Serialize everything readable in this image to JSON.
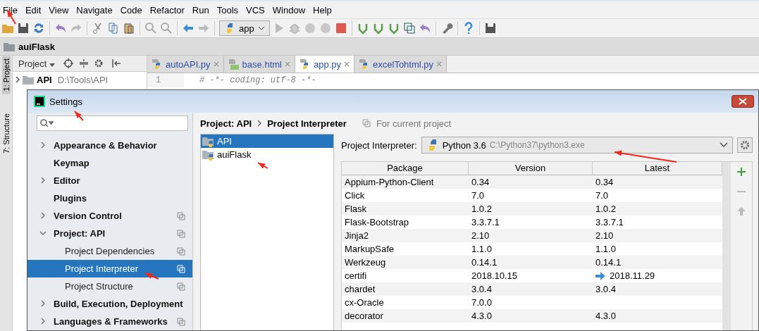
{
  "menu": [
    "File",
    "Edit",
    "View",
    "Navigate",
    "Code",
    "Refactor",
    "Run",
    "Tools",
    "VCS",
    "Window",
    "Help"
  ],
  "toolbar": {
    "run_config": "app"
  },
  "navbar": {
    "breadcrumb": "auiFlask"
  },
  "tool_strip": [
    {
      "label": "1: Project",
      "selected": true
    },
    {
      "label": "7: Structure",
      "selected": false
    }
  ],
  "project_panel": {
    "title": "Project",
    "tree": [
      {
        "name": "API",
        "path": "D:\\Tools\\API",
        "expanded": false
      }
    ]
  },
  "editor": {
    "tabs": [
      {
        "label": "autoAPI.py",
        "kind": "python",
        "selected": false
      },
      {
        "label": "base.html",
        "kind": "html",
        "selected": false
      },
      {
        "label": "app.py",
        "kind": "python",
        "selected": true
      },
      {
        "label": "excelTohtml.py",
        "kind": "python",
        "selected": false
      }
    ],
    "lines": [
      {
        "number": "1",
        "text": "# -*- coding: utf-8 -*-"
      }
    ]
  },
  "settings": {
    "title": "Settings",
    "nav": [
      {
        "label": "Appearance & Behavior",
        "kind": "group",
        "expanded": false,
        "selected": false,
        "project_scoped": false
      },
      {
        "label": "Keymap",
        "kind": "page",
        "selected": false,
        "project_scoped": false
      },
      {
        "label": "Editor",
        "kind": "group",
        "expanded": false,
        "selected": false,
        "project_scoped": false
      },
      {
        "label": "Plugins",
        "kind": "page",
        "selected": false,
        "project_scoped": false
      },
      {
        "label": "Version Control",
        "kind": "group",
        "expanded": false,
        "selected": false,
        "project_scoped": true
      },
      {
        "label": "Project: API",
        "kind": "group",
        "expanded": true,
        "selected": false,
        "project_scoped": true,
        "children": [
          {
            "label": "Project Dependencies",
            "selected": false,
            "project_scoped": true
          },
          {
            "label": "Project Interpreter",
            "selected": true,
            "project_scoped": true
          },
          {
            "label": "Project Structure",
            "selected": false,
            "project_scoped": true
          }
        ]
      },
      {
        "label": "Build, Execution, Deployment",
        "kind": "group",
        "expanded": false,
        "selected": false,
        "project_scoped": false
      },
      {
        "label": "Languages & Frameworks",
        "kind": "group",
        "expanded": false,
        "selected": false,
        "project_scoped": true
      }
    ],
    "breadcrumb": [
      "Project: API",
      "Project Interpreter"
    ],
    "scope_note": "For current project",
    "projects": [
      {
        "name": "API",
        "selected": true
      },
      {
        "name": "auiFlask",
        "selected": false
      }
    ],
    "interpreter": {
      "label": "Project Interpreter:",
      "name": "Python 3.6",
      "path": "C:\\Python37\\python3.exe"
    },
    "table": {
      "columns": [
        "Package",
        "Version",
        "Latest"
      ],
      "rows": [
        {
          "package": "Appium-Python-Client",
          "version": "0.34",
          "latest": "0.34",
          "upgrade": false
        },
        {
          "package": "Click",
          "version": "7.0",
          "latest": "7.0",
          "upgrade": false
        },
        {
          "package": "Flask",
          "version": "1.0.2",
          "latest": "1.0.2",
          "upgrade": false
        },
        {
          "package": "Flask-Bootstrap",
          "version": "3.3.7.1",
          "latest": "3.3.7.1",
          "upgrade": false
        },
        {
          "package": "Jinja2",
          "version": "2.10",
          "latest": "2.10",
          "upgrade": false
        },
        {
          "package": "MarkupSafe",
          "version": "1.1.0",
          "latest": "1.1.0",
          "upgrade": false
        },
        {
          "package": "Werkzeug",
          "version": "0.14.1",
          "latest": "0.14.1",
          "upgrade": false
        },
        {
          "package": "certifi",
          "version": "2018.10.15",
          "latest": "2018.11.29",
          "upgrade": true
        },
        {
          "package": "chardet",
          "version": "3.0.4",
          "latest": "3.0.4",
          "upgrade": false
        },
        {
          "package": "cx-Oracle",
          "version": "7.0.0",
          "upgrade": false
        },
        {
          "package": "decorator",
          "version": "4.3.0",
          "latest": "4.3.0",
          "upgrade": false
        }
      ]
    }
  }
}
